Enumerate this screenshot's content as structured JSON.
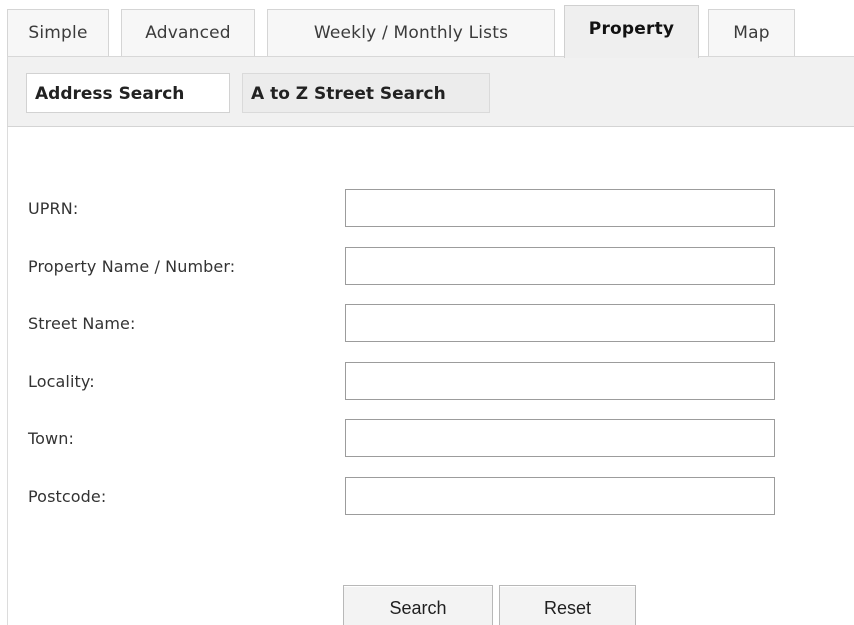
{
  "tabs": [
    {
      "label": "Simple"
    },
    {
      "label": "Advanced"
    },
    {
      "label": "Weekly / Monthly Lists"
    },
    {
      "label": "Property"
    },
    {
      "label": "Map"
    }
  ],
  "subnav": [
    {
      "label": "Address Search"
    },
    {
      "label": "A to Z Street Search"
    }
  ],
  "form": {
    "fields": [
      {
        "label": "UPRN:",
        "value": "",
        "placeholder": ""
      },
      {
        "label": "Property Name / Number:",
        "value": "",
        "placeholder": ""
      },
      {
        "label": "Street Name:",
        "value": "",
        "placeholder": ""
      },
      {
        "label": "Locality:",
        "value": "",
        "placeholder": ""
      },
      {
        "label": "Town:",
        "value": "",
        "placeholder": ""
      },
      {
        "label": "Postcode:",
        "value": "",
        "placeholder": ""
      }
    ],
    "buttons": {
      "search": "Search",
      "reset": "Reset"
    }
  },
  "colors": {
    "active_tab": "#efefef",
    "border": "#d5d5d5",
    "field_border": "#9c9c9c"
  }
}
